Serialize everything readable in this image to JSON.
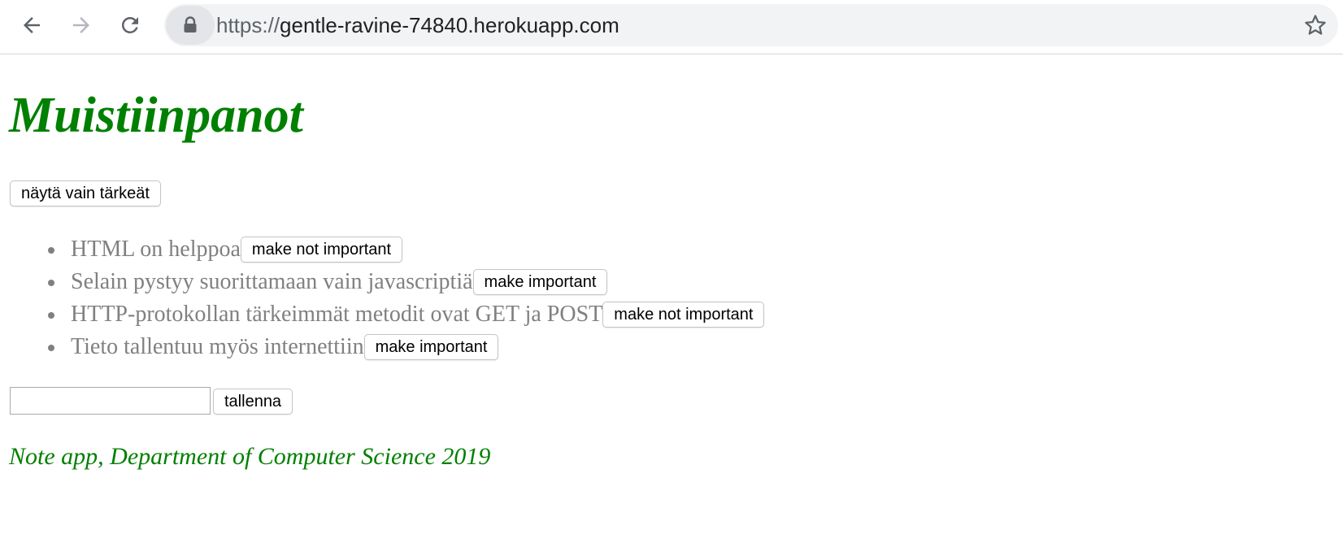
{
  "browser": {
    "url_scheme": "https://",
    "url_host": "gentle-ravine-74840.herokuapp.com"
  },
  "page": {
    "title": "Muistiinpanot",
    "filter_button_label": "näytä vain tärkeät",
    "notes": [
      {
        "content": "HTML on helppoa",
        "toggle_label": "make not important"
      },
      {
        "content": "Selain pystyy suorittamaan vain javascriptiä",
        "toggle_label": "make important"
      },
      {
        "content": "HTTP-protokollan tärkeimmät metodit ovat GET ja POST",
        "toggle_label": "make not important"
      },
      {
        "content": "Tieto tallentuu myös internettiin",
        "toggle_label": "make important"
      }
    ],
    "new_note_value": "",
    "save_button_label": "tallenna",
    "footer": "Note app, Department of Computer Science 2019"
  },
  "colors": {
    "title_green": "#008000",
    "note_text_gray": "#808080"
  },
  "icons": {
    "back": "arrow-left-icon",
    "forward": "arrow-right-icon",
    "reload": "reload-icon",
    "secure": "lock-icon",
    "bookmark": "star-icon"
  }
}
